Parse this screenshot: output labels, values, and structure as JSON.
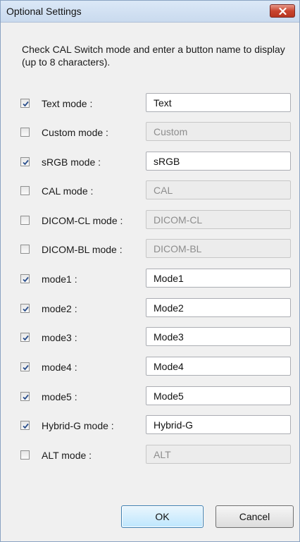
{
  "window": {
    "title": "Optional Settings",
    "close_icon": "close-icon"
  },
  "instructions": "Check CAL Switch mode and enter a button name to display (up to 8 characters).",
  "modes": [
    {
      "label": "Text mode :",
      "value": "Text",
      "checked": true
    },
    {
      "label": "Custom mode :",
      "value": "Custom",
      "checked": false
    },
    {
      "label": "sRGB mode :",
      "value": "sRGB",
      "checked": true
    },
    {
      "label": "CAL mode :",
      "value": "CAL",
      "checked": false
    },
    {
      "label": "DICOM-CL mode :",
      "value": "DICOM-CL",
      "checked": false
    },
    {
      "label": "DICOM-BL mode :",
      "value": "DICOM-BL",
      "checked": false
    },
    {
      "label": "mode1 :",
      "value": "Mode1",
      "checked": true
    },
    {
      "label": "mode2 :",
      "value": "Mode2",
      "checked": true
    },
    {
      "label": "mode3 :",
      "value": "Mode3",
      "checked": true
    },
    {
      "label": "mode4 :",
      "value": "Mode4",
      "checked": true
    },
    {
      "label": "mode5 :",
      "value": "Mode5",
      "checked": true
    },
    {
      "label": "Hybrid-G mode :",
      "value": "Hybrid-G",
      "checked": true
    },
    {
      "label": "ALT mode :",
      "value": "ALT",
      "checked": false
    }
  ],
  "buttons": {
    "ok": "OK",
    "cancel": "Cancel"
  }
}
